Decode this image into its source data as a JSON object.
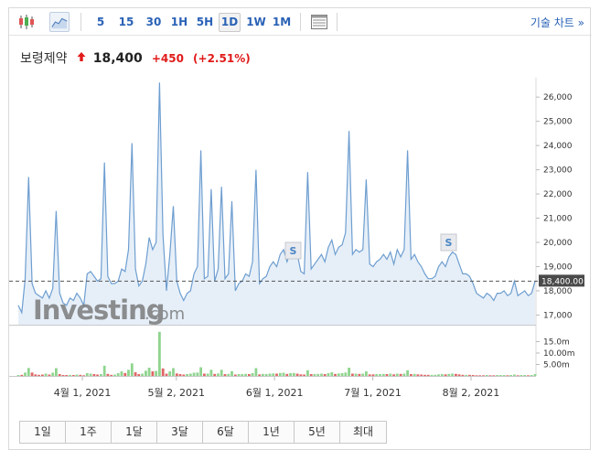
{
  "toolbar": {
    "candle_icon": "candlestick-icon",
    "area_icon": "area-chart-icon",
    "intervals": [
      "5",
      "15",
      "30",
      "1H",
      "5H",
      "1D",
      "1W",
      "1M"
    ],
    "active_interval": "1D",
    "table_icon": "table-icon",
    "tech_chart_label": "기술 차트",
    "tech_chart_arrow": "»"
  },
  "quote": {
    "name": "보령제약",
    "price": "18,400",
    "change": "+450",
    "change_pct": "(+2.51%)",
    "direction_icon": "up-arrow-icon",
    "up_color": "#e01a1a"
  },
  "chart_data": {
    "type": "area",
    "y_ticks": [
      "26,000",
      "25,000",
      "24,000",
      "23,000",
      "22,000",
      "21,000",
      "20,000",
      "19,000",
      "18,000",
      "17,000"
    ],
    "ylim": [
      16600,
      26800
    ],
    "last_price_label": "18,400.00",
    "last_price": 18400,
    "x_ticks": [
      "4월 1, 2021",
      "5월 2, 2021",
      "6월 1, 2021",
      "7월 1, 2021",
      "8월 2, 2021"
    ],
    "volume_ticks": [
      "15.0m",
      "10.00m",
      "5.00m"
    ],
    "volume_max": 20,
    "watermark": "Investing",
    "watermark_suffix": ".com",
    "split_marker": "S",
    "series": [
      {
        "values": [
          17400,
          17100,
          18500,
          22700,
          18300,
          17900,
          17800,
          17700,
          18000,
          17700,
          18100,
          21300,
          17900,
          17500,
          17400,
          17700,
          17600,
          17900,
          17700,
          17400,
          18700,
          18800,
          18600,
          18400,
          18500,
          23300,
          18600,
          18300,
          18300,
          18400,
          18900,
          18800,
          19700,
          24100,
          18900,
          18200,
          18400,
          19100,
          20200,
          19700,
          20000,
          26600,
          20300,
          18000,
          19500,
          21500,
          18400,
          17900,
          17600,
          17900,
          18000,
          18700,
          19000,
          23800,
          18500,
          18600,
          22200,
          18400,
          18900,
          22300,
          18500,
          18700,
          21700,
          18000,
          18300,
          18400,
          18700,
          18600,
          19200,
          23000,
          18300,
          18500,
          18600,
          19000,
          19200,
          19000,
          19500,
          19700,
          19200,
          19600,
          19800,
          19500,
          18800,
          18700,
          22900,
          18900,
          19100,
          19300,
          19500,
          19200,
          19800,
          20100,
          19500,
          19800,
          19900,
          20400,
          24600,
          19500,
          19700,
          19600,
          19700,
          22600,
          19100,
          19000,
          19200,
          19300,
          19500,
          19300,
          19600,
          19100,
          19700,
          19400,
          19700,
          23800,
          19300,
          19500,
          19200,
          19000,
          18700,
          18500,
          18500,
          18600,
          19000,
          19200,
          19000,
          19400,
          19600,
          19500,
          19100,
          18700,
          18700,
          18600,
          18300,
          17900,
          17800,
          17700,
          17900,
          17800,
          17600,
          17900,
          17900,
          18000,
          17800,
          17900,
          18400,
          17800,
          17900,
          18000,
          17800,
          17900,
          18400
        ]
      }
    ],
    "volume": [
      0.4,
      0.5,
      1.5,
      3.5,
      1.5,
      0.7,
      0.5,
      0.6,
      1.0,
      0.6,
      1.4,
      3.4,
      0.8,
      0.4,
      0.4,
      0.5,
      0.4,
      0.6,
      0.5,
      0.3,
      1.2,
      1.0,
      0.8,
      0.6,
      0.8,
      4.5,
      0.9,
      0.5,
      0.6,
      1.2,
      2.0,
      1.3,
      2.7,
      5.5,
      1.6,
      0.8,
      1.0,
      2.3,
      3.6,
      2.0,
      2.2,
      19.3,
      3.3,
      1.0,
      2.0,
      3.4,
      1.1,
      0.8,
      0.6,
      0.8,
      1.0,
      1.4,
      1.5,
      3.8,
      1.0,
      1.0,
      2.7,
      0.9,
      1.1,
      2.7,
      0.8,
      0.9,
      2.1,
      0.6,
      0.8,
      0.8,
      0.9,
      0.8,
      1.2,
      3.4,
      0.7,
      0.9,
      0.8,
      1.0,
      1.1,
      1.0,
      1.3,
      1.4,
      0.9,
      1.2,
      1.3,
      1.0,
      0.7,
      0.6,
      2.5,
      0.8,
      0.8,
      0.9,
      1.0,
      0.8,
      1.2,
      1.6,
      0.9,
      1.1,
      1.2,
      1.5,
      3.6,
      1.0,
      1.0,
      0.9,
      1.0,
      2.0,
      0.7,
      0.7,
      0.8,
      0.8,
      0.9,
      0.8,
      1.0,
      0.7,
      1.0,
      0.9,
      1.0,
      2.5,
      0.8,
      0.9,
      0.7,
      0.6,
      0.5,
      0.5,
      0.5,
      0.5,
      0.7,
      0.8,
      0.7,
      0.9,
      1.0,
      0.9,
      0.7,
      0.5,
      0.5,
      0.5,
      0.4,
      0.3,
      0.3,
      0.3,
      0.4,
      0.3,
      0.3,
      0.4,
      0.4,
      0.4,
      0.3,
      0.4,
      0.6,
      0.3,
      0.4,
      0.4,
      0.3,
      0.4,
      0.8
    ]
  },
  "ranges": [
    "1일",
    "1주",
    "1달",
    "3달",
    "6달",
    "1년",
    "5년",
    "최대"
  ],
  "colors": {
    "line": "#6e9ed0",
    "fill": "#e6eff8",
    "vol_up": "#8fd48f",
    "vol_down": "#e06666",
    "link": "#2a62b6"
  }
}
